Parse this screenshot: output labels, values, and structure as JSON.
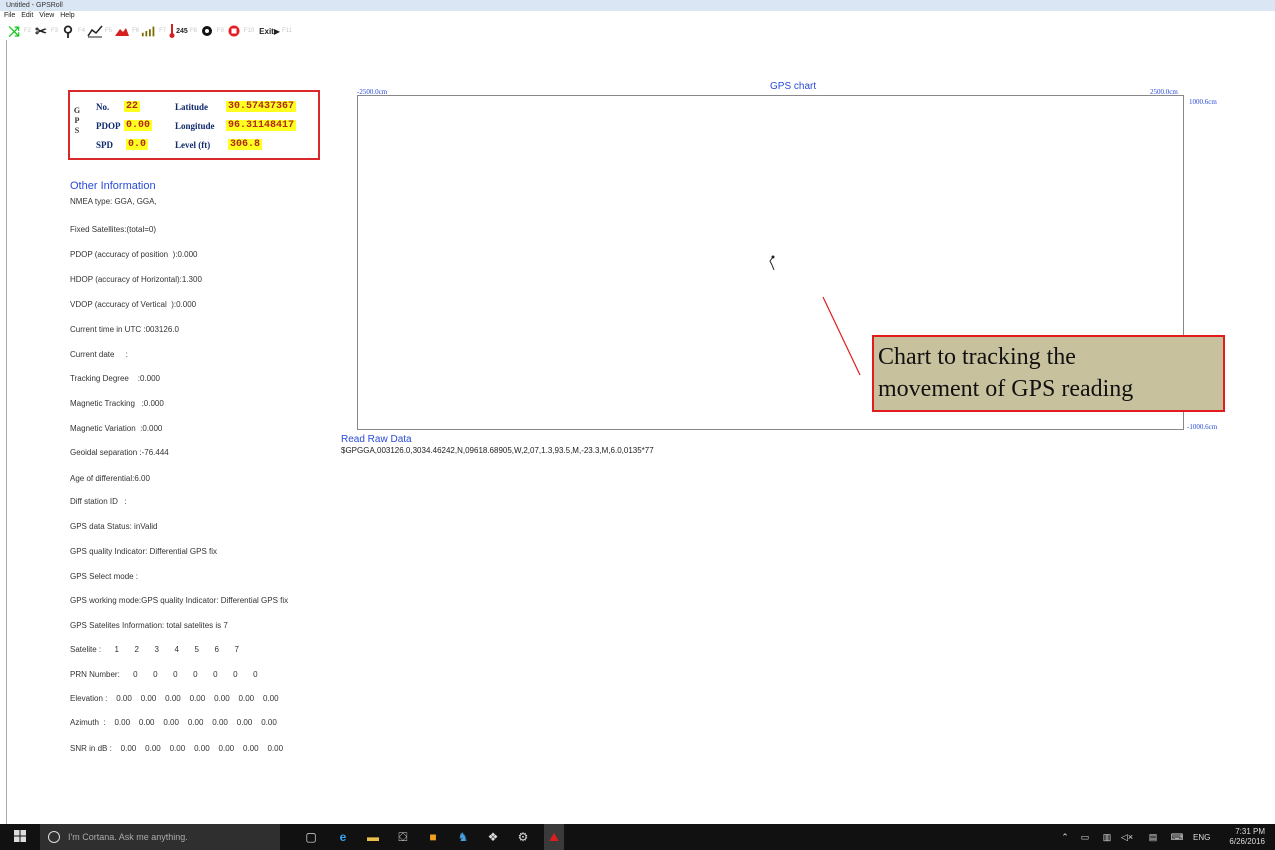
{
  "window": {
    "title": "Untitled - GPSRoll"
  },
  "menu": [
    "File",
    "Edit",
    "View",
    "Help"
  ],
  "toolbar": {
    "keys": [
      "F2",
      "F3",
      "F4",
      "F5",
      "F6",
      "F7",
      "F8",
      "F9",
      "F10",
      "F11"
    ],
    "signal_value": "245",
    "exit_label": "Exit"
  },
  "gps_box": {
    "vertical_label": "GPS",
    "no_label": "No.",
    "no_value": "22",
    "lat_label": "Latitude",
    "lat_value": "30.57437367",
    "pdop_label": "PDOP",
    "pdop_value": "0.00",
    "lon_label": "Longitude",
    "lon_value": "96.31148417",
    "spd_label": "SPD",
    "spd_value": "0.0",
    "level_label": "Level (ft)",
    "level_value": "306.8"
  },
  "other": {
    "title": "Other Information",
    "lines": [
      "NMEA type: GGA, GGA,",
      "Fixed Satellites:(total=0)",
      "PDOP (accuracy of position  ):0.000",
      "HDOP (accuracy of Horizontal):1.300",
      "VDOP (accuracy of Vertical  ):0.000",
      "Current time in UTC :003126.0",
      "Current date     :",
      "Tracking Degree    :0.000",
      "Magnetic Tracking   :0.000",
      "Magnetic Variation  :0.000",
      "Geoidal separation :-76.444",
      "Age of differential:6.00",
      "Diff station ID   :",
      "GPS data Status: inValid",
      "GPS quality Indicator: Differential GPS fix",
      "GPS Select mode :",
      "GPS working mode:GPS quality Indicator: Differential GPS fix",
      "GPS Satelites Information: total satelites is 7",
      "Satelite :      1       2       3       4       5       6       7",
      "PRN Number:      0       0       0       0       0       0       0",
      "Elevation :    0.00    0.00    0.00    0.00    0.00    0.00    0.00",
      "Azimuth  :    0.00    0.00    0.00    0.00    0.00    0.00    0.00",
      "SNR in dB :    0.00    0.00    0.00    0.00    0.00    0.00    0.00"
    ]
  },
  "chart": {
    "title": "GPS chart",
    "top_left": "-2500.0cm",
    "top_right": "2500.0cm",
    "right_top": "1000.6cm",
    "right_bottom": "-1000.6cm"
  },
  "raw": {
    "title": "Read Raw Data",
    "text": "$GPGGA,003126.0,3034.46242,N,09618.68905,W,2,07,1.3,93.5,M,-23.3,M,6.0,0135*77"
  },
  "callout": {
    "line1": "Chart to tracking the",
    "line2": "movement of GPS reading",
    "color": "#e21c1c"
  },
  "taskbar": {
    "search_placeholder": "I'm Cortana. Ask me anything.",
    "lang": "ENG",
    "time": "7:31 PM",
    "date": "6/26/2016"
  }
}
